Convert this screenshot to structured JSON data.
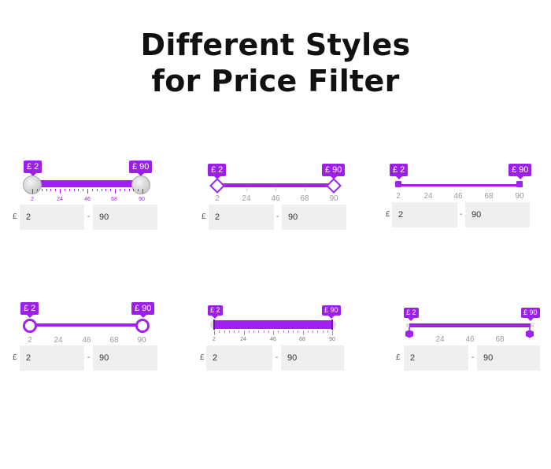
{
  "heading": {
    "line1": "Different Styles",
    "line2": "for Price Filter"
  },
  "accent_color": "#a020f0",
  "widgets": [
    {
      "badge_min": "£ 2",
      "badge_max": "£ 90",
      "ticks": [
        "2",
        "24",
        "46",
        "68",
        "90"
      ],
      "currency": "£",
      "dash": "-",
      "min_value": "2",
      "max_value": "90"
    },
    {
      "badge_min": "£ 2",
      "badge_max": "£ 90",
      "ticks": [
        "2",
        "24",
        "46",
        "68",
        "90"
      ],
      "currency": "£",
      "dash": "-",
      "min_value": "2",
      "max_value": "90"
    },
    {
      "badge_min": "£ 2",
      "badge_max": "£ 90",
      "ticks": [
        "2",
        "24",
        "46",
        "68",
        "90"
      ],
      "currency": "£",
      "dash": "-",
      "min_value": "2",
      "max_value": "90"
    },
    {
      "badge_min": "£ 2",
      "badge_max": "£ 90",
      "ticks": [
        "2",
        "24",
        "46",
        "68",
        "90"
      ],
      "currency": "£",
      "dash": "-",
      "min_value": "2",
      "max_value": "90"
    },
    {
      "badge_min": "£ 2",
      "badge_max": "£ 90",
      "ticks": [
        "2",
        "24",
        "46",
        "68",
        "90"
      ],
      "currency": "£",
      "dash": "-",
      "min_value": "2",
      "max_value": "90"
    },
    {
      "badge_min": "£ 2",
      "badge_max": "£ 90",
      "ticks": [
        "24",
        "46",
        "68"
      ],
      "currency": "£",
      "dash": "-",
      "min_value": "2",
      "max_value": "90"
    }
  ]
}
